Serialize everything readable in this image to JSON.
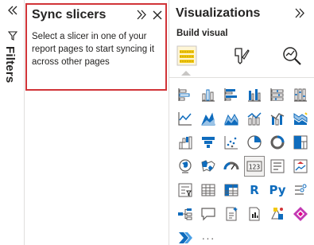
{
  "filters": {
    "label": "Filters"
  },
  "sync_slicers": {
    "title": "Sync slicers",
    "description": "Select a slicer in one of your report pages to start syncing it across other pages"
  },
  "visualizations": {
    "title": "Visualizations",
    "build_label": "Build visual",
    "r_visual_label": "R",
    "python_visual_label": "Py",
    "more_label": "···"
  },
  "colors": {
    "accent_blue": "#0f6cbd",
    "highlight_red": "#d13438",
    "yellow": "#f2c811"
  }
}
